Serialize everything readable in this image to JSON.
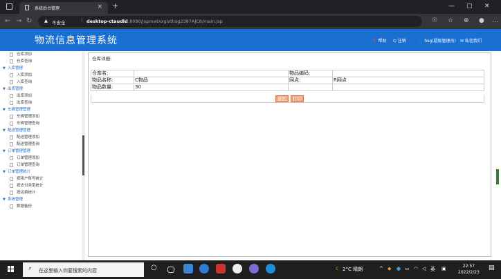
{
  "browser": {
    "tab_title": "系统后台管理",
    "tab_close": "×",
    "new_tab": "+",
    "security_warning": "不安全",
    "url_host": "desktop-ctaudld",
    "url_path": ":8080/jspmwlxxglxthsg2387AJC8/main.jsp",
    "win_min": "—",
    "win_max": "▢",
    "win_close": "✕"
  },
  "app": {
    "title": "物流信息管理系统",
    "help": "帮助",
    "logout": "注销",
    "user": "hsg(超级管理员)",
    "message": "私信我们"
  },
  "sidebar": {
    "items": [
      {
        "type": "item",
        "label": "仓库添加"
      },
      {
        "type": "item",
        "label": "仓库查询"
      },
      {
        "type": "group",
        "label": "入库管理"
      },
      {
        "type": "item",
        "label": "入库添加"
      },
      {
        "type": "item",
        "label": "入库查询"
      },
      {
        "type": "group",
        "label": "出库管理"
      },
      {
        "type": "item",
        "label": "出库添加"
      },
      {
        "type": "item",
        "label": "出库查询"
      },
      {
        "type": "group",
        "label": "车辆管理管理"
      },
      {
        "type": "item",
        "label": "车辆管理添加"
      },
      {
        "type": "item",
        "label": "车辆管理查询"
      },
      {
        "type": "group",
        "label": "配送管理管理"
      },
      {
        "type": "item",
        "label": "配送管理添加"
      },
      {
        "type": "item",
        "label": "配送管理查询"
      },
      {
        "type": "group",
        "label": "订单管理管理"
      },
      {
        "type": "item",
        "label": "订单管理添加"
      },
      {
        "type": "item",
        "label": "订单管理查询"
      },
      {
        "type": "group",
        "label": "订单管理统计"
      },
      {
        "type": "item",
        "label": "按用户账号统计"
      },
      {
        "type": "item",
        "label": "按支付类型统计"
      },
      {
        "type": "item",
        "label": "按运费统计"
      },
      {
        "type": "group",
        "label": "系统管理"
      },
      {
        "type": "item",
        "label": "数据备份"
      }
    ]
  },
  "detail": {
    "caption": "仓库详细:",
    "rows": [
      {
        "l1": "仓库名:",
        "v1": "",
        "l2": "物品编码:",
        "v2": ""
      },
      {
        "l1": "物品名称:",
        "v1": "C物品",
        "l2": "网点:",
        "v2": "R网点"
      },
      {
        "l1": "物品数量:",
        "v1": "30",
        "l2": "",
        "v2": ""
      }
    ],
    "back_button": "返回",
    "print_button": "打印"
  },
  "taskbar": {
    "search_placeholder": "在这里输入你要搜索的内容",
    "weather": "2°C 晴朗",
    "ime": "英",
    "time": "22:57",
    "date": "2022/2/23"
  },
  "colors": {
    "header": "#1a6fd1",
    "button": "#f0a07a"
  }
}
